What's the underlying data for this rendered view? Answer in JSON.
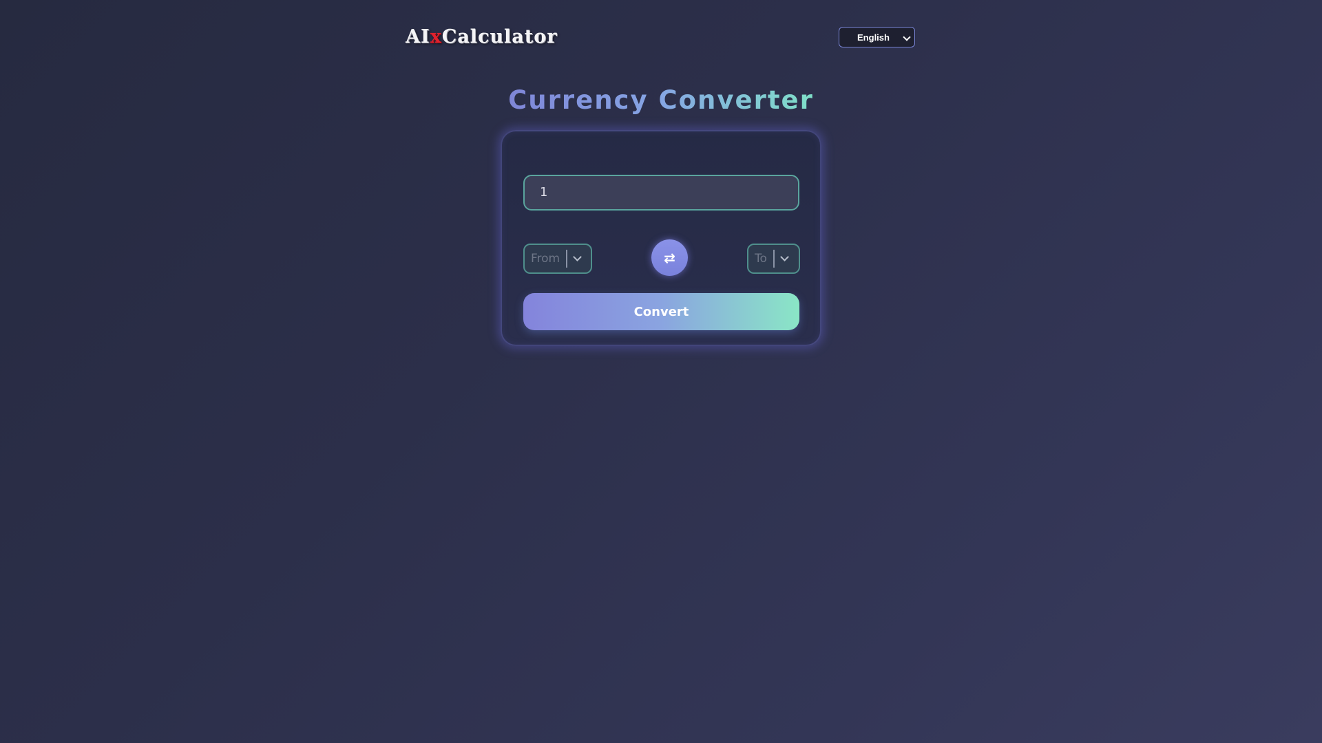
{
  "header": {
    "logo": {
      "part1": "AI",
      "part2": "x",
      "part3": "Calculator"
    },
    "language_select": {
      "selected": "English"
    }
  },
  "main": {
    "title": "Currency Converter",
    "amount_input": {
      "value": "1"
    },
    "from_select": {
      "placeholder": "From"
    },
    "to_select": {
      "placeholder": "To"
    },
    "swap_button": {
      "icon": "swap-arrows-icon",
      "glyph": "⇄"
    },
    "convert_button": {
      "label": "Convert"
    }
  },
  "colors": {
    "background": "#2c2f4a",
    "accent_purple": "#7f86d8",
    "accent_teal": "#8ae6c6",
    "logo_x_red": "#e0222e"
  }
}
